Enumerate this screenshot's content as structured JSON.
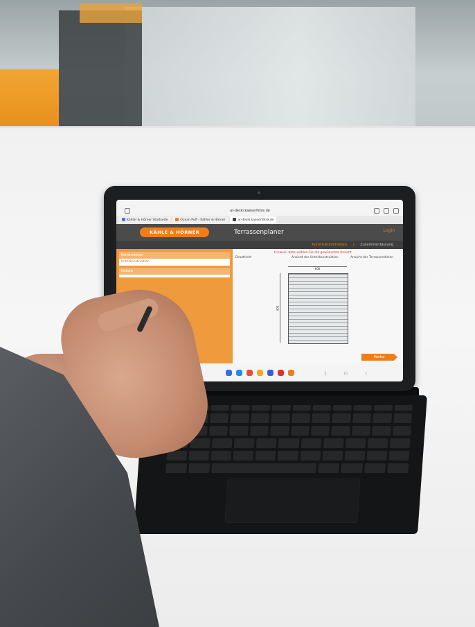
{
  "browser": {
    "url": "ar-deski.kaeserfetre.de",
    "tabs": [
      {
        "label": "Kähler & Hörner Startseite",
        "color": "#4a7bd0"
      },
      {
        "label": "Ocean Puff - Kähler & Hörner",
        "color": "#ef7d1a"
      },
      {
        "label": "ar-deski.kaeserfetre.de",
        "color": "#444444"
      }
    ]
  },
  "app": {
    "logo": "KÄHLE & HÖRNER",
    "title": "Terrassenplaner",
    "brand_link": "Login",
    "steps": [
      "Konstruktion/Details",
      "Zusammenfassung"
    ],
    "accent": "#ef7d1a"
  },
  "sidebar": {
    "panels": [
      {
        "head": "Konstruktion",
        "body": "Unterkonstruktion"
      },
      {
        "head": "Details",
        "body": ""
      }
    ]
  },
  "main": {
    "note": "Hinweis: bitte wählen Sie die gewünschte Ansicht",
    "labels": [
      "Draufsicht",
      "Ansicht der Unterkonstruktion",
      "Ansicht der Terrassendielen"
    ],
    "dim_width": "600",
    "dim_depth": "400",
    "next_button": "Weiter"
  },
  "dock": {
    "apps": [
      "#2f6fe0",
      "#1f8cf0",
      "#e84b3c",
      "#f5a623",
      "#3b5bdb",
      "#e03131",
      "#ef7d1a"
    ]
  }
}
